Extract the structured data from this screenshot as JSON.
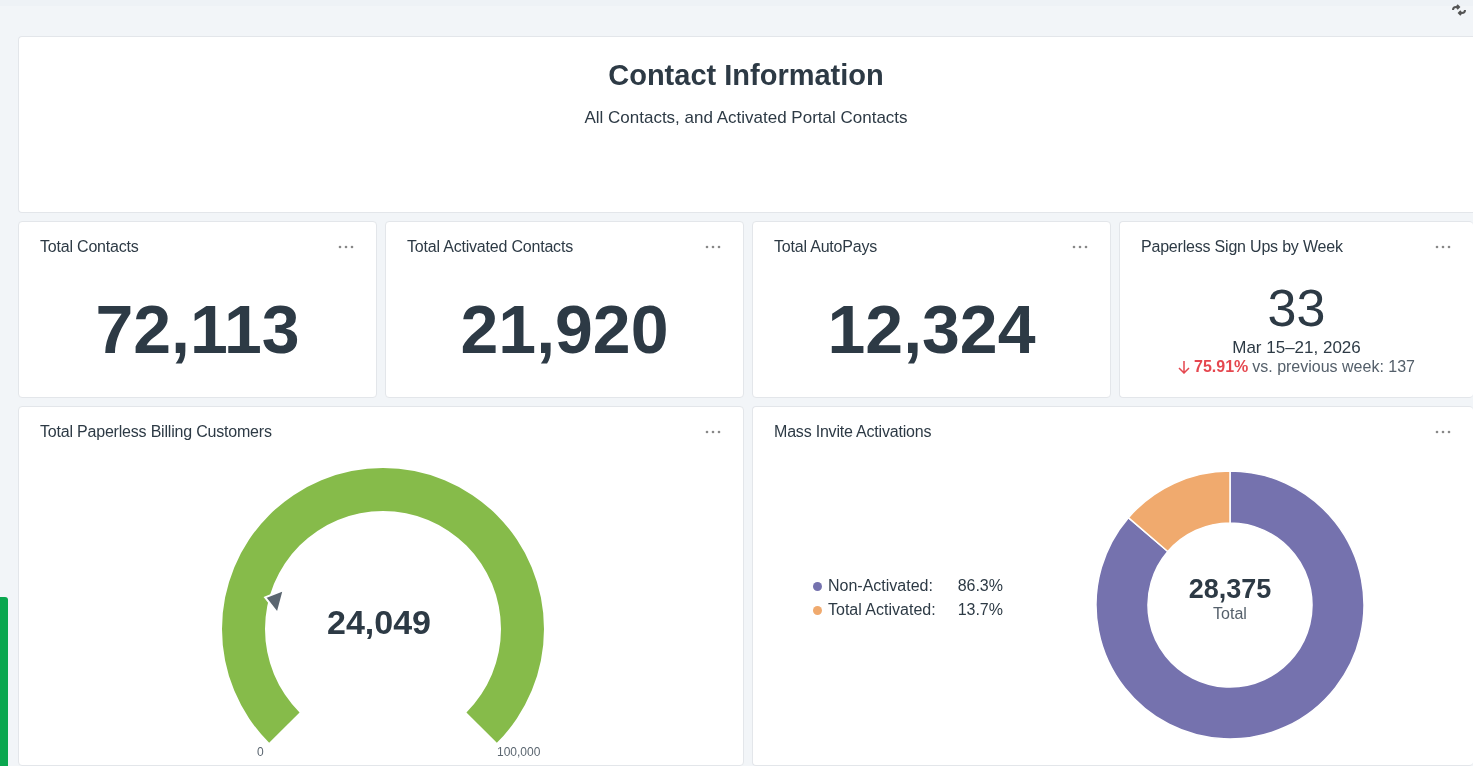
{
  "header": {
    "title": "Contact Information",
    "subtitle": "All Contacts, and Activated Portal Contacts"
  },
  "kpis": [
    {
      "title": "Total Contacts",
      "value": "72,113"
    },
    {
      "title": "Total Activated Contacts",
      "value": "21,920"
    },
    {
      "title": "Total AutoPays",
      "value": "12,324"
    }
  ],
  "weekly": {
    "title": "Paperless Sign Ups by Week",
    "value": "33",
    "period": "Mar 15–21, 2026",
    "change": "75.91%",
    "comparison": "vs. previous week: 137"
  },
  "gauge": {
    "title": "Total Paperless Billing Customers",
    "value": "24,049",
    "min_label": "0",
    "max_label": "100,000"
  },
  "donut": {
    "title": "Mass Invite Activations",
    "total": "28,375",
    "total_label": "Total",
    "legend": [
      {
        "label": "Non-Activated:",
        "value": "86.3%",
        "color": "#7572ae"
      },
      {
        "label": "Total Activated:",
        "value": "13.7%",
        "color": "#f0aa6e"
      }
    ],
    "chart_data": {
      "type": "donut",
      "series": [
        {
          "values": [
            86.3,
            13.7
          ]
        }
      ]
    }
  }
}
